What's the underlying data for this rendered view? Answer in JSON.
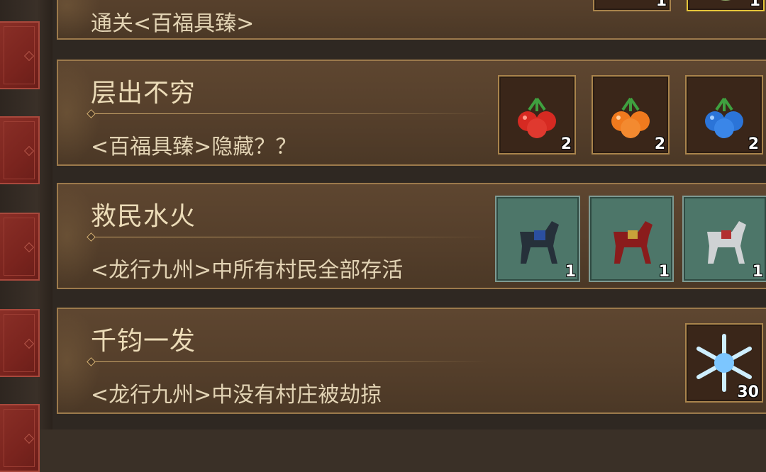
{
  "achievements": [
    {
      "title": "",
      "description": "通关<百福具臻>",
      "rewards": [
        {
          "icon": "star-burst-icon",
          "count": "1"
        },
        {
          "icon": "demon-portrait-icon",
          "count": "1"
        }
      ]
    },
    {
      "title": "层出不穷",
      "description": "<百福具臻>隐藏？？",
      "rewards": [
        {
          "icon": "red-fruit-icon",
          "count": "2"
        },
        {
          "icon": "orange-fruit-icon",
          "count": "2"
        },
        {
          "icon": "blue-fruit-icon",
          "count": "2"
        }
      ]
    },
    {
      "title": "救民水火",
      "description": "<龙行九州>中所有村民全部存活",
      "rewards": [
        {
          "icon": "black-horse-icon",
          "count": "1"
        },
        {
          "icon": "red-horse-icon",
          "count": "1"
        },
        {
          "icon": "white-horse-icon",
          "count": "1"
        }
      ]
    },
    {
      "title": "千钧一发",
      "description": "<龙行九州>中没有村庄被劫掠",
      "rewards": [
        {
          "icon": "ice-crystal-icon",
          "count": "30"
        }
      ]
    }
  ],
  "colors": {
    "panel": "#553f2b",
    "panel_border": "#9c7a4c",
    "side_tab": "#7a241e",
    "title_text": "#ecdcb8"
  }
}
